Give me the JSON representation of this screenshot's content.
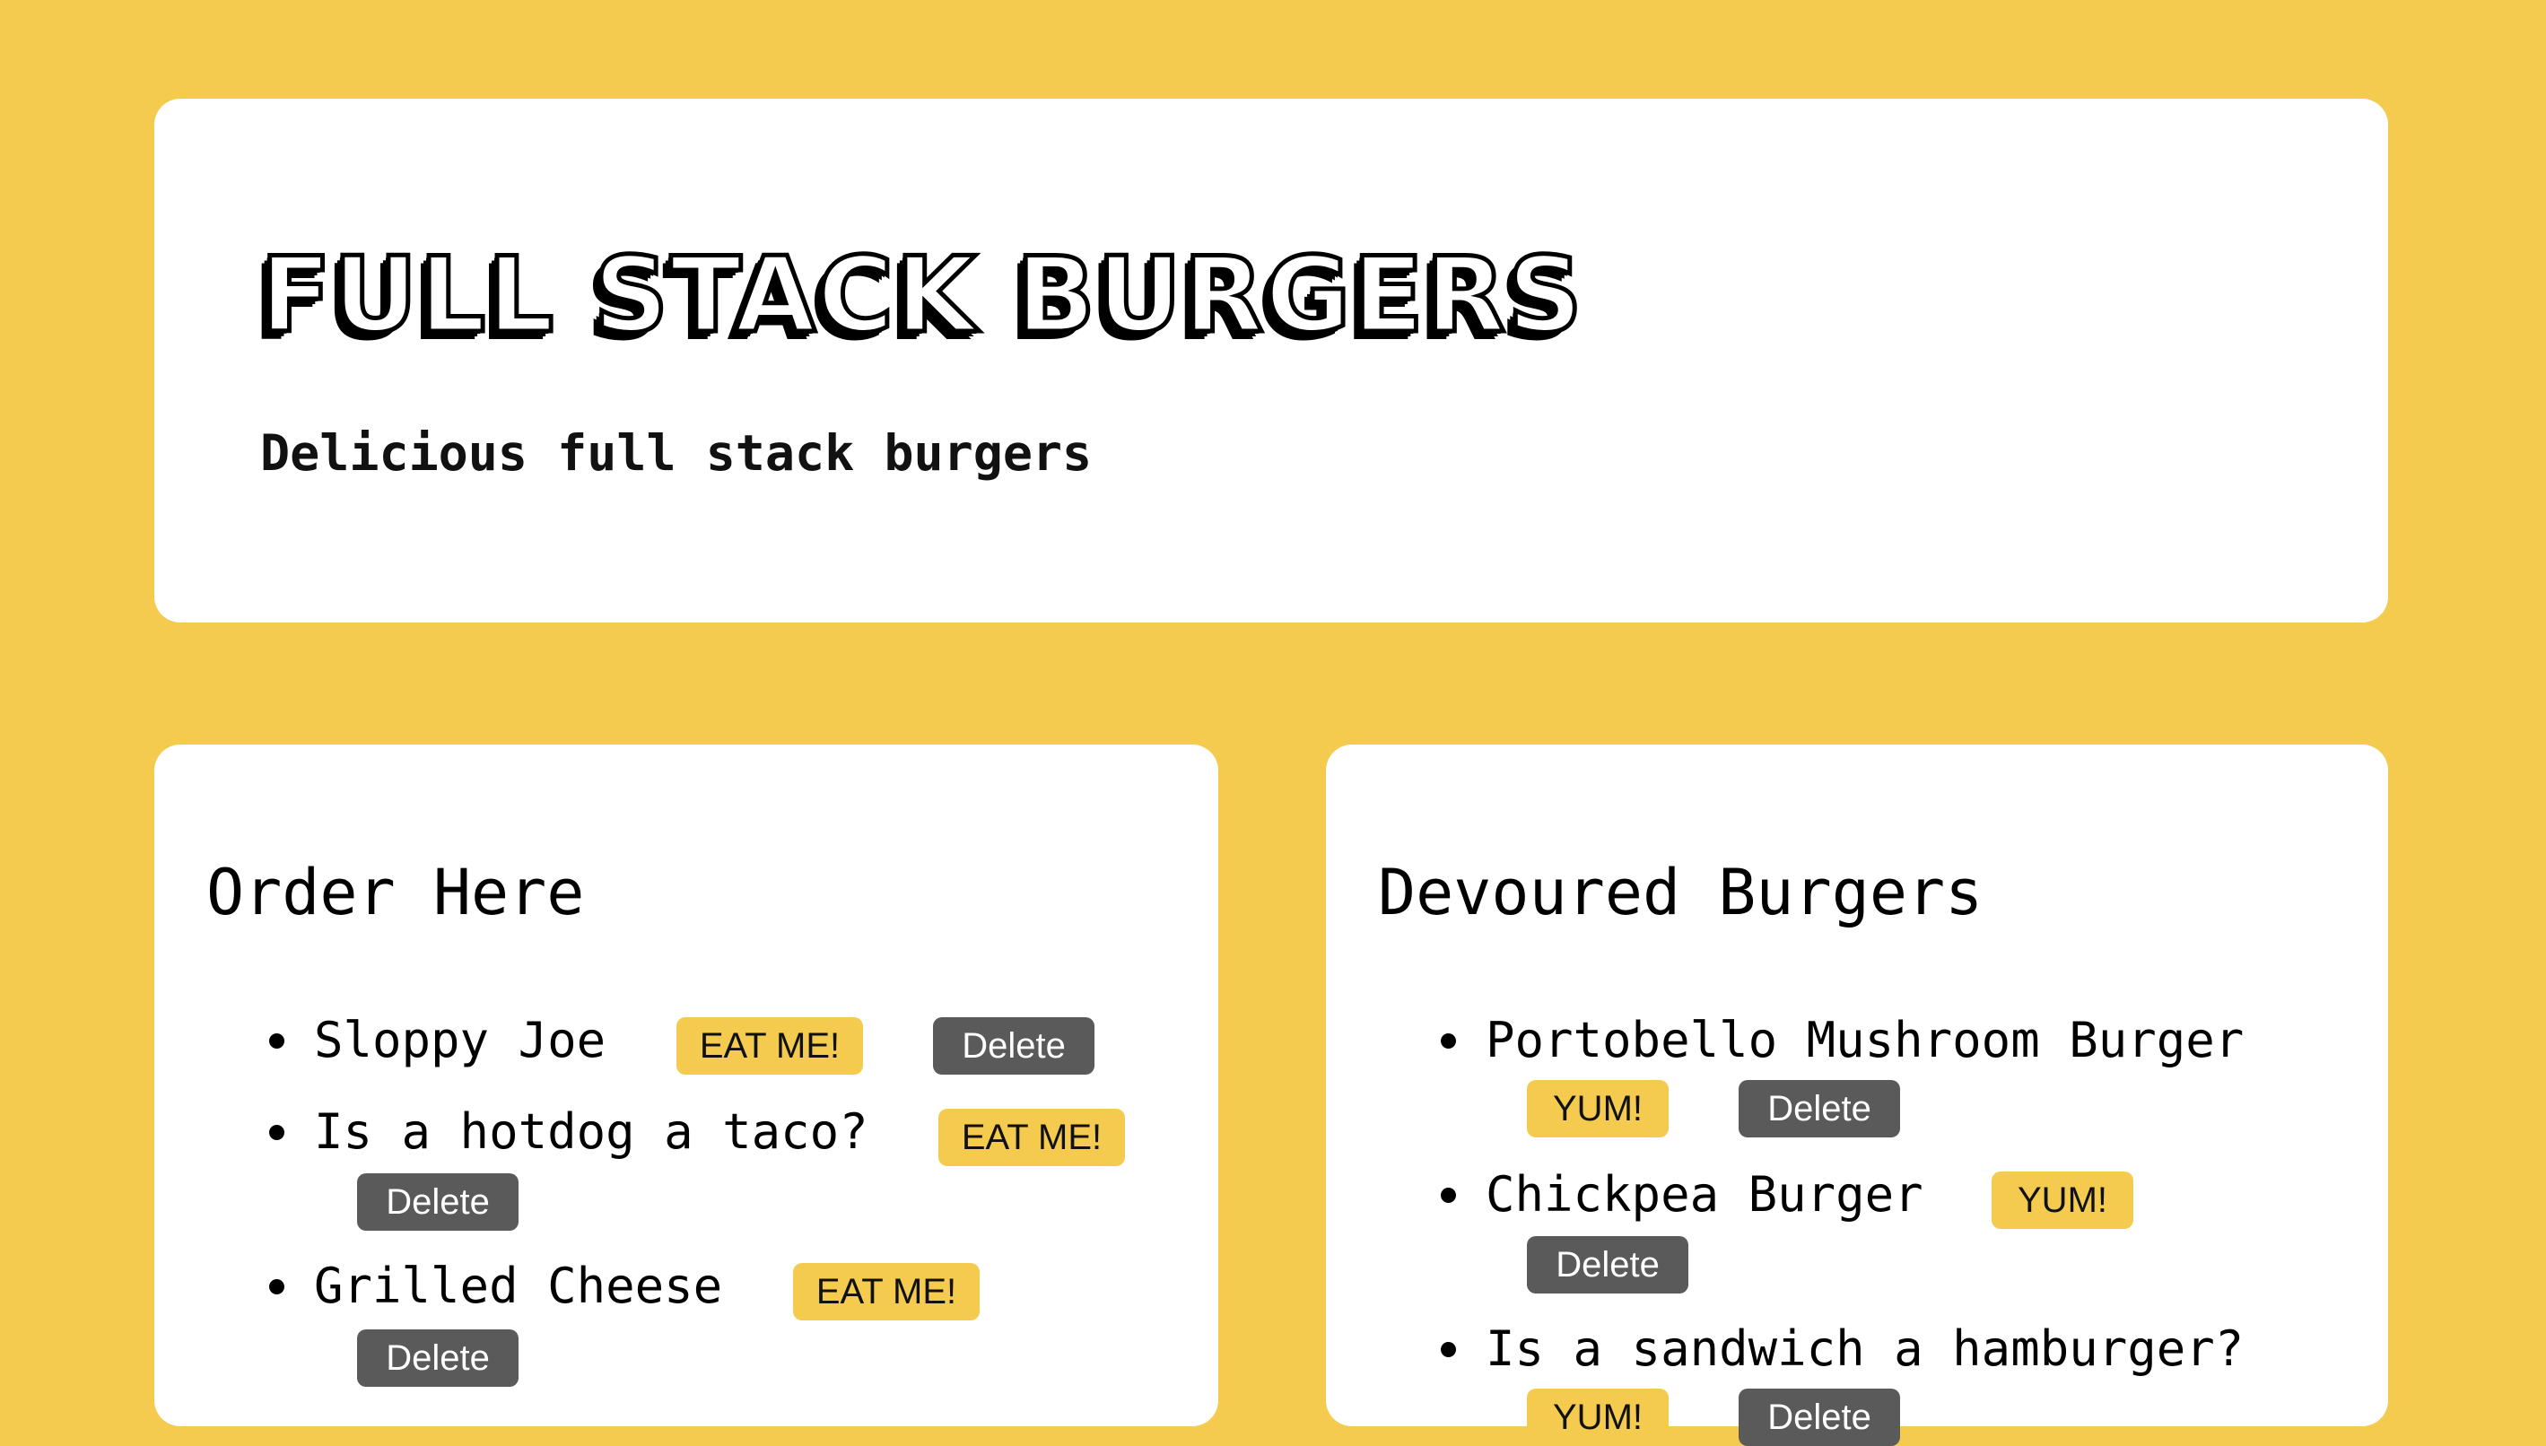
{
  "header": {
    "title": "FULL STACK BURGERS",
    "subtitle": "Delicious full stack burgers"
  },
  "order": {
    "title": "Order Here",
    "items": [
      {
        "name": "Sloppy Joe",
        "eat_label": "EAT ME!",
        "delete_label": "Delete"
      },
      {
        "name": "Is a hotdog a taco?",
        "eat_label": "EAT ME!",
        "delete_label": "Delete"
      },
      {
        "name": "Grilled Cheese",
        "eat_label": "EAT ME!",
        "delete_label": "Delete"
      }
    ]
  },
  "devoured": {
    "title": "Devoured Burgers",
    "items": [
      {
        "name": "Portobello Mushroom Burger",
        "yum_label": "YUM!",
        "delete_label": "Delete"
      },
      {
        "name": "Chickpea Burger",
        "yum_label": "YUM!",
        "delete_label": "Delete"
      },
      {
        "name": "Is a sandwich a hamburger?",
        "yum_label": "YUM!",
        "delete_label": "Delete"
      }
    ]
  },
  "colors": {
    "background": "#F4CB4F",
    "card": "#FFFFFF",
    "eat_button": "#F4CB4F",
    "delete_button": "#5A5A5A"
  }
}
